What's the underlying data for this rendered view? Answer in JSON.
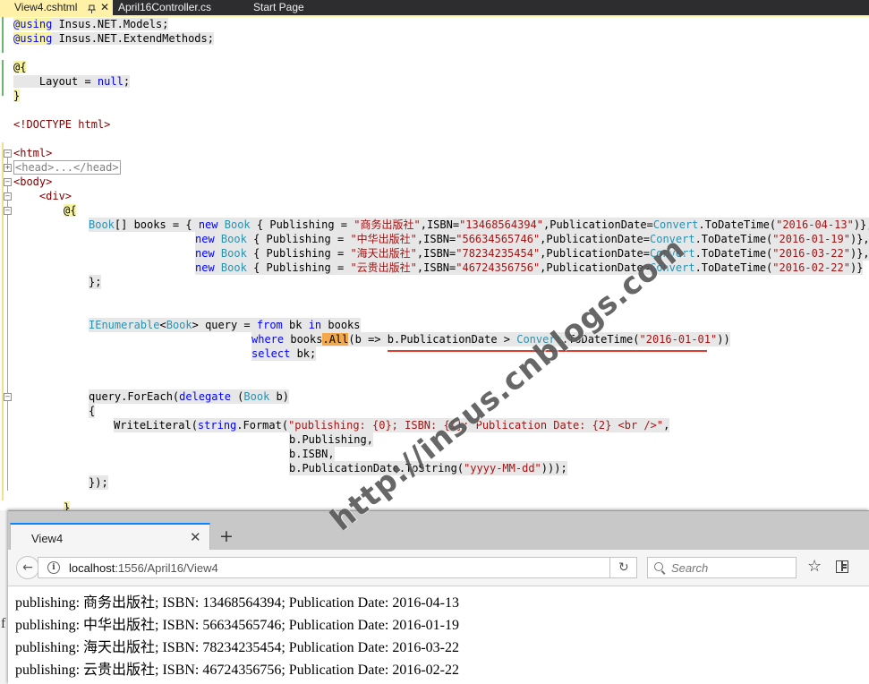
{
  "editor": {
    "tabs": [
      {
        "label": "View4.cshtml",
        "active": true
      },
      {
        "label": "April16Controller.cs",
        "active": false
      },
      {
        "label": "Start Page",
        "active": false
      }
    ],
    "code": {
      "l1_kw": "@using",
      "l1_ns": " Insus.NET.Models;",
      "l2_kw": "@using",
      "l2_ns": " Insus.NET.ExtendMethods;",
      "l4": "@{",
      "l5_a": "    Layout = ",
      "l5_null": "null",
      "l5_b": ";",
      "l6": "}",
      "l8": "<!DOCTYPE html>",
      "l10": "<html>",
      "l11": "<head>...</head>",
      "l12": "<body>",
      "l13": "    <div>",
      "l14": "@{",
      "book_type": "Book",
      "books_decl": "[] books = { ",
      "new": "new",
      "pub_label": "{ Publishing = ",
      "isbn_label": ",ISBN=",
      "pubdate_label": ",PublicationDate=",
      "convert": "Convert",
      "todatetime": ".ToDateTime(",
      "books": [
        {
          "publishing": "\"商务出版社\"",
          "isbn": "\"13468564394\"",
          "date": "\"2016-04-13\"",
          "end": ")},"
        },
        {
          "publishing": "\"中华出版社\"",
          "isbn": "\"56634565746\"",
          "date": "\"2016-01-19\"",
          "end": ")},"
        },
        {
          "publishing": "\"海天出版社\"",
          "isbn": "\"78234235454\"",
          "date": "\"2016-03-22\"",
          "end": ")},"
        },
        {
          "publishing": "\"云贵出版社\"",
          "isbn": "\"46724356756\"",
          "date": "\"2016-02-22\"",
          "end": ")}"
        }
      ],
      "close_array": "};",
      "ienumerable": "IEnumerable",
      "query_decl_b": "> query = ",
      "from": "from",
      "bk": " bk ",
      "in": "in",
      "books_word": " books",
      "where": "where",
      "books_dot": " books",
      "all": ".All",
      "lambda": "(b => b.PublicationDate > ",
      "date_filter": "\"2016-01-01\"",
      "paren_close": "))",
      "select": "select",
      "select_rest": " bk;",
      "foreach": "query.ForEach(",
      "delegate": "delegate",
      "book_b": " b)",
      "brace_open": "{",
      "writeliteral": "WriteLiteral(",
      "string": "string",
      "format": ".Format(",
      "format_str": "\"publishing: {0}; ISBN: {1}; Publication Date: {2} <br />\"",
      "comma": ",",
      "arg1": "b.Publishing,",
      "arg2": "b.ISBN,",
      "arg3": "b.PublicationDate.ToString(",
      "fmt": "\"yyyy-MM-dd\"",
      "arg3_end": ")));",
      "close_foreach": "});",
      "close_brace": "}"
    }
  },
  "watermark": "http://insus.cnblogs.com",
  "browser": {
    "tab_title": "View4",
    "url_host": "localhost",
    "url_path": ":1556/April16/View4",
    "search_placeholder": "Search",
    "output": [
      "publishing: 商务出版社; ISBN: 13468564394; Publication Date: 2016-04-13",
      "publishing: 中华出版社; ISBN: 56634565746; Publication Date: 2016-01-19",
      "publishing: 海天出版社; ISBN: 78234235454; Publication Date: 2016-03-22",
      "publishing: 云贵出版社; ISBN: 46724356756; Publication Date: 2016-02-22"
    ],
    "left_edge_char": "f"
  },
  "colors": {
    "keyword": "#0000ff",
    "type": "#2b91af",
    "string": "#a31515",
    "tag": "#800000",
    "active_tab": "#fff1a8",
    "underline": "#e23b2e"
  }
}
